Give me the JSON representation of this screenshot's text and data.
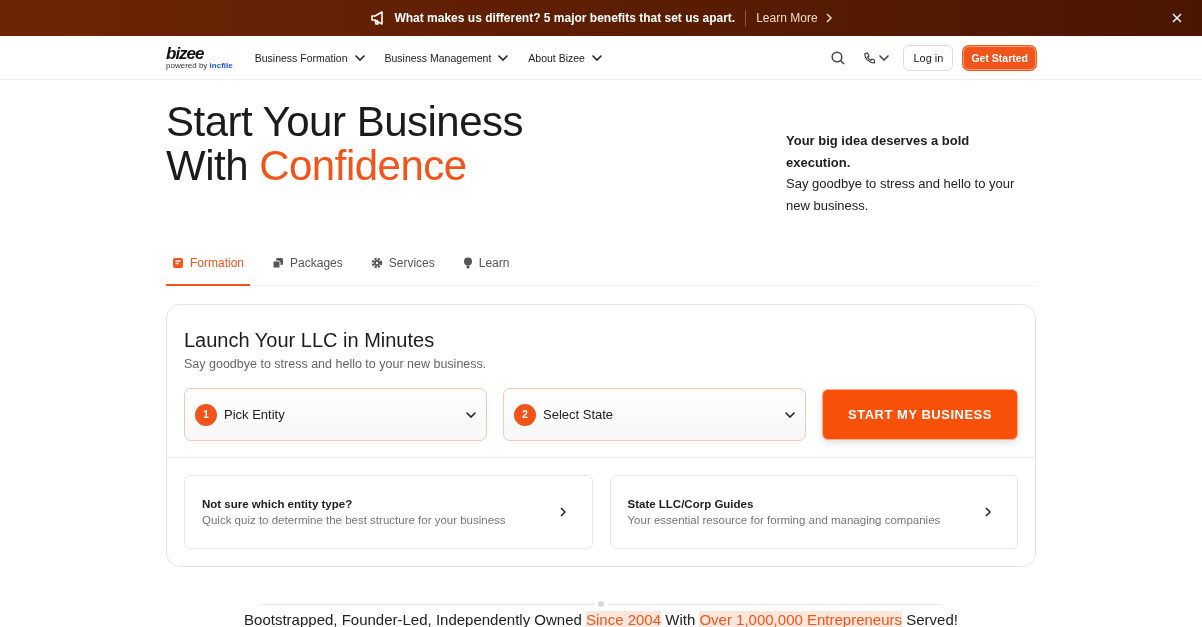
{
  "banner": {
    "message": "What makes us different? 5 major benefits that set us apart.",
    "link": "Learn More"
  },
  "logo": {
    "name": "bizee",
    "tagline_prefix": "powered by",
    "tagline_brand": "incfile"
  },
  "nav": [
    {
      "label": "Business Formation"
    },
    {
      "label": "Business Management"
    },
    {
      "label": "About Bizee"
    }
  ],
  "actions": {
    "login": "Log in",
    "cta": "Get Started"
  },
  "hero": {
    "title_line1": "Start Your Business",
    "title_line2_prefix": "With",
    "title_line2_accent": "Confidence",
    "side_bold": "Your big idea deserves a bold execution.",
    "side_text": "Say goodbye to stress and hello to your new business."
  },
  "tabs": [
    {
      "label": "Formation",
      "selected": true
    },
    {
      "label": "Packages",
      "selected": false
    },
    {
      "label": "Services",
      "selected": false
    },
    {
      "label": "Learn",
      "selected": false
    }
  ],
  "card": {
    "title": "Launch Your LLC in Minutes",
    "subtitle": "Say goodbye to stress and hello to your new business.",
    "selects": [
      {
        "step": "1",
        "placeholder": "Pick Entity"
      },
      {
        "step": "2",
        "placeholder": "Select State"
      }
    ],
    "button": "START MY BUSINESS",
    "links": [
      {
        "title": "Not sure which entity type?",
        "text": "Quick quiz to determine the best structure for your business"
      },
      {
        "title": "State LLC/Corp Guides",
        "text": "Your essential resource for forming and managing companies"
      }
    ]
  },
  "footer_line": {
    "parts": [
      {
        "text": "Bootstrapped, Founder-Led, Independently Owned",
        "highlight": false
      },
      {
        "text": "Since 2004",
        "highlight": true
      },
      {
        "text": "With",
        "highlight": false
      },
      {
        "text": "Over 1,000,000 Entrepreneurs",
        "highlight": true
      },
      {
        "text": "Served!",
        "highlight": false
      }
    ]
  }
}
